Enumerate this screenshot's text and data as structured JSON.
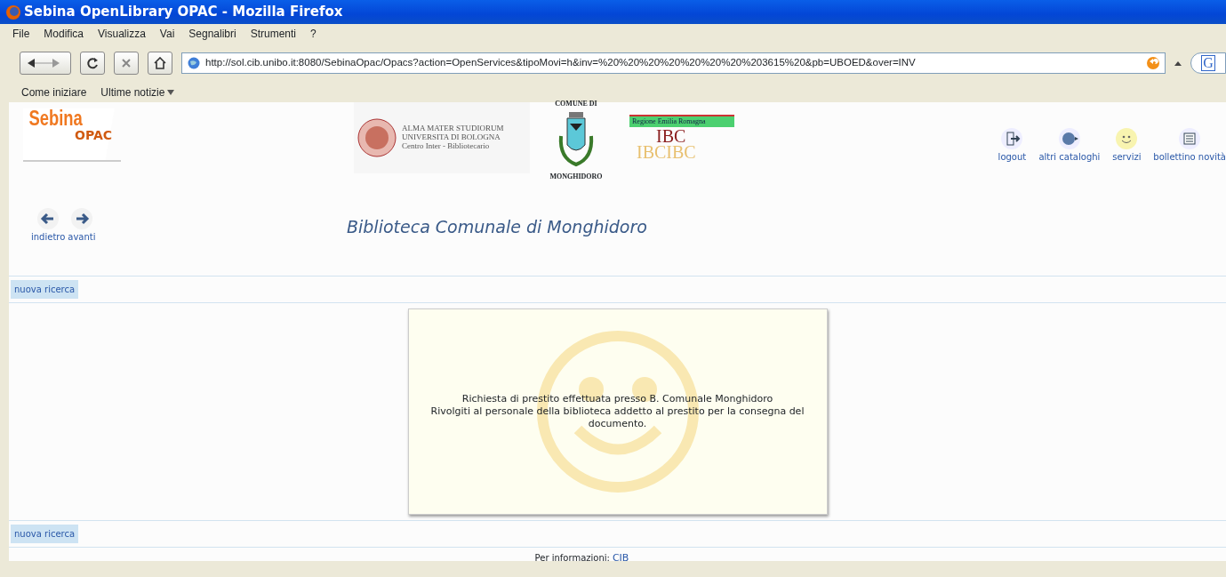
{
  "window": {
    "title": "Sebina OpenLibrary OPAC - Mozilla Firefox"
  },
  "menu": [
    "File",
    "Modifica",
    "Visualizza",
    "Vai",
    "Segnalibri",
    "Strumenti",
    "?"
  ],
  "address": {
    "value": "http://sol.cib.unibo.it:8080/SebinaOpac/Opacs?action=OpenServices&tipoMovi=h&inv=%20%20%20%20%20%20%20%203615%20&pb=UBOED&over=INV"
  },
  "search_engine": {
    "letter": "G"
  },
  "bookmarks": [
    {
      "label": "Come iniziare",
      "kind": "link"
    },
    {
      "label": "Ultime notizie",
      "kind": "folder"
    }
  ],
  "header": {
    "logo": {
      "line1": "Sebina",
      "line2": "OPAC"
    },
    "university_logo": {
      "lines": [
        "ALMA MATER STUDIORUM",
        "UNIVERSITA DI BOLOGNA",
        "Centro Inter - Bibliotecario"
      ]
    },
    "comune_logo": {
      "top": "COMUNE DI",
      "bottom": "MONGHIDORO"
    },
    "region_logo": {
      "banner": "Regione Emilia Romagna",
      "word": "IBC",
      "echo": "IBCIBC"
    },
    "tools": [
      {
        "label": "logout",
        "kind": "logout"
      },
      {
        "label": "altri cataloghi",
        "kind": "globe"
      },
      {
        "label": "servizi",
        "kind": "smiley"
      },
      {
        "label": "bollettino novità",
        "kind": "news"
      }
    ]
  },
  "nav": [
    {
      "label": "indietro",
      "kind": "back"
    },
    {
      "label": "avanti",
      "kind": "forward"
    }
  ],
  "library_title": "Biblioteca Comunale di Monghidoro",
  "top_link": "nuova ricerca",
  "message": {
    "lines": [
      "Richiesta di prestito effettuata presso B. Comunale Monghidoro",
      "Rivolgiti al personale della biblioteca addetto al prestito per la consegna del documento."
    ]
  },
  "bottom_link": "nuova ricerca",
  "footer": {
    "label": "Per informazioni:",
    "link": "CIB"
  }
}
